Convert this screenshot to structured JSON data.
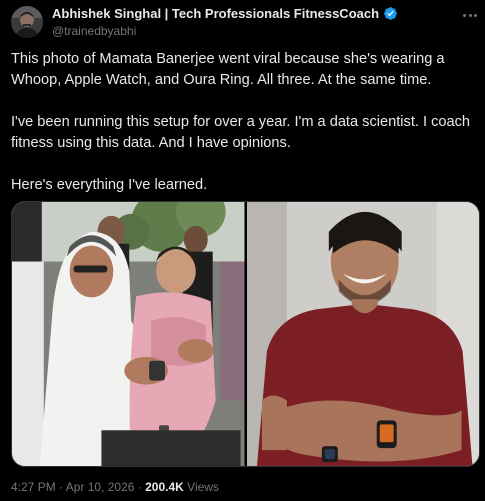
{
  "author": {
    "display_name": "Abhishek Singhal | Tech Professionals FitnessCoach",
    "handle": "@trainedbyabhi",
    "verified_badge_color": "#1d9bf0"
  },
  "post": {
    "paragraphs": [
      "This photo of Mamata Banerjee went viral because she's wearing a Whoop, Apple Watch, and Oura Ring. All three. At the same time.",
      "I've been running this setup for over a year. I'm a data scientist. I coach fitness using this data. And I have opinions.",
      "Here's everything I've learned."
    ]
  },
  "media": {
    "images": [
      {
        "icon": "photo-woman-holding-child"
      },
      {
        "icon": "photo-man-smiling-arms-crossed"
      }
    ]
  },
  "meta": {
    "time": "4:27 PM",
    "separator": "·",
    "date": "Apr 10, 2026",
    "views_count": "200.4K",
    "views_label": "Views"
  },
  "icons": {
    "more": "more-horizontal-icon",
    "verified": "verified-badge-icon"
  },
  "colors": {
    "background": "#000000",
    "text_primary": "#e7e9ea",
    "text_secondary": "#71767b",
    "border": "#2f3336"
  }
}
